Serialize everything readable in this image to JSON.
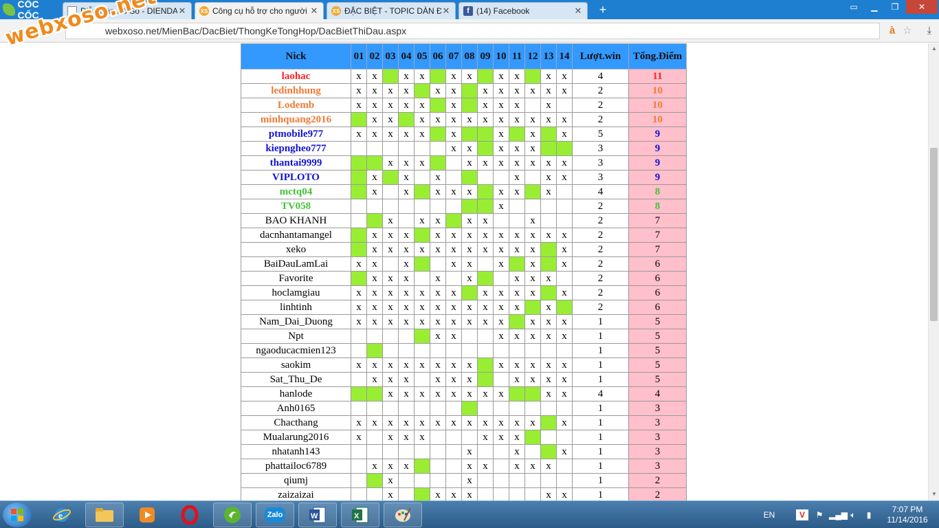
{
  "browser": {
    "brand": "CỐC CỐC",
    "tabs": [
      {
        "title": "Diễn Đàn Xổ Số - DIENDAN...",
        "icon": "document-icon"
      },
      {
        "title": "Công cụ hỗ trợ cho người chơi",
        "icon": "xs-icon",
        "active": true
      },
      {
        "title": "ĐẶC BIỆT - TOPIC DÀN ĐẶC BIỆT",
        "icon": "xs-icon"
      },
      {
        "title": "(14) Facebook",
        "icon": "facebook-icon"
      }
    ],
    "url": "webxoso.net/MienBac/DacBiet/ThongKeTongHop/DacBietThiDau.aspx"
  },
  "watermark": "webxoso.net",
  "table": {
    "headers": [
      "Nick",
      "01",
      "02",
      "03",
      "04",
      "05",
      "06",
      "07",
      "08",
      "09",
      "10",
      "11",
      "12",
      "13",
      "14",
      "Lượt.win",
      "Tổng.Điểm"
    ],
    "rows": [
      {
        "nick": "laohac",
        "class": "c1",
        "cells": [
          "x",
          "x",
          "G",
          "x",
          "x",
          "G",
          "x",
          "x",
          "G",
          "x",
          "x",
          "G",
          "x",
          "x"
        ],
        "wins": "4",
        "score": "11"
      },
      {
        "nick": "ledinhhung",
        "class": "c2",
        "cells": [
          "x",
          "x",
          "x",
          "x",
          "G",
          "x",
          "x",
          "G",
          "x",
          "x",
          "x",
          "x",
          "x",
          "x"
        ],
        "wins": "2",
        "score": "10"
      },
      {
        "nick": "Lodemb",
        "class": "c2",
        "cells": [
          "x",
          "x",
          "x",
          "x",
          "x",
          "G",
          "x",
          "G",
          "x",
          "x",
          "x",
          "",
          "x",
          ""
        ],
        "wins": "2",
        "score": "10"
      },
      {
        "nick": "minhquang2016",
        "class": "c2",
        "cells": [
          "G",
          "x",
          "x",
          "G",
          "x",
          "x",
          "x",
          "x",
          "x",
          "x",
          "x",
          "x",
          "x",
          "x"
        ],
        "wins": "2",
        "score": "10"
      },
      {
        "nick": "ptmobile977",
        "class": "c3",
        "cells": [
          "x",
          "x",
          "x",
          "x",
          "x",
          "G",
          "x",
          "G",
          "G",
          "x",
          "G",
          "x",
          "G",
          "x"
        ],
        "wins": "5",
        "score": "9"
      },
      {
        "nick": "kiepngheo777",
        "class": "c3",
        "cells": [
          "",
          "",
          "",
          "",
          "",
          "",
          "x",
          "x",
          "G",
          "x",
          "x",
          "x",
          "G",
          "G"
        ],
        "wins": "3",
        "score": "9"
      },
      {
        "nick": "thantai9999",
        "class": "c3",
        "cells": [
          "G",
          "G",
          "x",
          "x",
          "x",
          "G",
          "",
          "x",
          "x",
          "x",
          "x",
          "x",
          "x",
          "x"
        ],
        "wins": "3",
        "score": "9"
      },
      {
        "nick": "VIPLOTO",
        "class": "c3",
        "cells": [
          "G",
          "x",
          "G",
          "x",
          "",
          "x",
          "",
          "G",
          "",
          "",
          "x",
          "",
          "x",
          "x"
        ],
        "wins": "3",
        "score": "9"
      },
      {
        "nick": "mctq04",
        "class": "c4",
        "cells": [
          "G",
          "x",
          "",
          "x",
          "G",
          "x",
          "x",
          "x",
          "G",
          "x",
          "x",
          "G",
          "x",
          ""
        ],
        "wins": "4",
        "score": "8"
      },
      {
        "nick": "TV058",
        "class": "c4",
        "cells": [
          "",
          "",
          "",
          "",
          "",
          "",
          "",
          "G",
          "G",
          "x",
          "",
          "",
          "",
          ""
        ],
        "wins": "2",
        "score": "8"
      },
      {
        "nick": "BAO KHANH",
        "class": "",
        "cells": [
          "",
          "G",
          "x",
          "",
          "x",
          "x",
          "G",
          "x",
          "x",
          "",
          "",
          "x",
          "",
          ""
        ],
        "wins": "2",
        "score": "7"
      },
      {
        "nick": "dacnhantamangel",
        "class": "",
        "cells": [
          "G",
          "x",
          "x",
          "x",
          "G",
          "x",
          "x",
          "x",
          "x",
          "x",
          "x",
          "x",
          "x",
          "x"
        ],
        "wins": "2",
        "score": "7"
      },
      {
        "nick": "xeko",
        "class": "",
        "cells": [
          "G",
          "x",
          "x",
          "x",
          "x",
          "x",
          "x",
          "x",
          "x",
          "x",
          "x",
          "x",
          "G",
          "x"
        ],
        "wins": "2",
        "score": "7"
      },
      {
        "nick": "BaiDauLamLai",
        "class": "",
        "cells": [
          "x",
          "x",
          "",
          "x",
          "G",
          "",
          "x",
          "x",
          "",
          "x",
          "G",
          "x",
          "G",
          "x"
        ],
        "wins": "2",
        "score": "6"
      },
      {
        "nick": "Favorite",
        "class": "",
        "cells": [
          "G",
          "x",
          "x",
          "x",
          "",
          "x",
          "",
          "x",
          "G",
          "",
          "x",
          "x",
          "x",
          ""
        ],
        "wins": "2",
        "score": "6"
      },
      {
        "nick": "hoclamgiau",
        "class": "",
        "cells": [
          "x",
          "x",
          "x",
          "x",
          "x",
          "x",
          "x",
          "G",
          "x",
          "x",
          "x",
          "x",
          "G",
          "x"
        ],
        "wins": "2",
        "score": "6"
      },
      {
        "nick": "linhtinh",
        "class": "",
        "cells": [
          "x",
          "x",
          "x",
          "x",
          "x",
          "x",
          "x",
          "x",
          "x",
          "x",
          "x",
          "G",
          "x",
          "G"
        ],
        "wins": "2",
        "score": "6"
      },
      {
        "nick": "Nam_Dai_Duong",
        "class": "",
        "cells": [
          "x",
          "x",
          "x",
          "x",
          "x",
          "x",
          "x",
          "x",
          "x",
          "x",
          "G",
          "x",
          "x",
          "x"
        ],
        "wins": "1",
        "score": "5"
      },
      {
        "nick": "Npt",
        "class": "",
        "cells": [
          "",
          "",
          "",
          "",
          "G",
          "x",
          "x",
          "",
          "",
          "x",
          "x",
          "x",
          "x",
          "x"
        ],
        "wins": "1",
        "score": "5"
      },
      {
        "nick": "ngaoducacmien123",
        "class": "",
        "cells": [
          "",
          "G",
          "",
          "",
          "",
          "",
          "",
          "",
          "",
          "",
          "",
          "",
          "",
          ""
        ],
        "wins": "1",
        "score": "5"
      },
      {
        "nick": "saokim",
        "class": "",
        "cells": [
          "x",
          "x",
          "x",
          "x",
          "x",
          "x",
          "x",
          "x",
          "G",
          "x",
          "x",
          "x",
          "x",
          "x"
        ],
        "wins": "1",
        "score": "5"
      },
      {
        "nick": "Sat_Thu_De",
        "class": "",
        "cells": [
          "",
          "x",
          "x",
          "x",
          "",
          "x",
          "x",
          "x",
          "G",
          "",
          "x",
          "x",
          "x",
          "x"
        ],
        "wins": "1",
        "score": "5"
      },
      {
        "nick": "hanlode",
        "class": "",
        "cells": [
          "G",
          "G",
          "x",
          "x",
          "x",
          "x",
          "x",
          "x",
          "x",
          "x",
          "G",
          "G",
          "x",
          "x"
        ],
        "wins": "4",
        "score": "4"
      },
      {
        "nick": "Anh0165",
        "class": "",
        "cells": [
          "",
          "",
          "",
          "",
          "",
          "",
          "",
          "G",
          "",
          "",
          "",
          "",
          "",
          ""
        ],
        "wins": "1",
        "score": "3"
      },
      {
        "nick": "Chacthang",
        "class": "",
        "cells": [
          "x",
          "x",
          "x",
          "x",
          "x",
          "x",
          "x",
          "x",
          "x",
          "x",
          "x",
          "x",
          "G",
          "x"
        ],
        "wins": "1",
        "score": "3"
      },
      {
        "nick": "Mualarung2016",
        "class": "",
        "cells": [
          "x",
          "",
          "x",
          "x",
          "x",
          "",
          "",
          "",
          "x",
          "x",
          "x",
          "G",
          "",
          ""
        ],
        "wins": "1",
        "score": "3"
      },
      {
        "nick": "nhatanh143",
        "class": "",
        "cells": [
          "",
          "",
          "",
          "",
          "",
          "",
          "",
          "x",
          "",
          "",
          "x",
          "",
          "G",
          "x"
        ],
        "wins": "1",
        "score": "3"
      },
      {
        "nick": "phattailoc6789",
        "class": "",
        "cells": [
          "",
          "x",
          "x",
          "x",
          "G",
          "",
          "",
          "x",
          "x",
          "",
          "x",
          "x",
          "x",
          ""
        ],
        "wins": "1",
        "score": "3"
      },
      {
        "nick": "qiumj",
        "class": "",
        "cells": [
          "",
          "G",
          "x",
          "",
          "",
          "",
          "",
          "x",
          "",
          "",
          "",
          "",
          "",
          ""
        ],
        "wins": "1",
        "score": "2"
      },
      {
        "nick": "zaizaizai",
        "class": "",
        "cells": [
          "",
          "",
          "x",
          "",
          "G",
          "x",
          "x",
          "x",
          "",
          "",
          "",
          "",
          "x",
          "x"
        ],
        "wins": "1",
        "score": "2"
      }
    ]
  },
  "taskbar": {
    "apps": [
      "internet-explorer",
      "file-explorer",
      "media-player",
      "opera",
      "coccoc",
      "zalo",
      "word",
      "excel",
      "paint"
    ],
    "zalo_label": "Zalo",
    "language": "EN",
    "time": "7:07 PM",
    "date": "11/14/2016"
  }
}
